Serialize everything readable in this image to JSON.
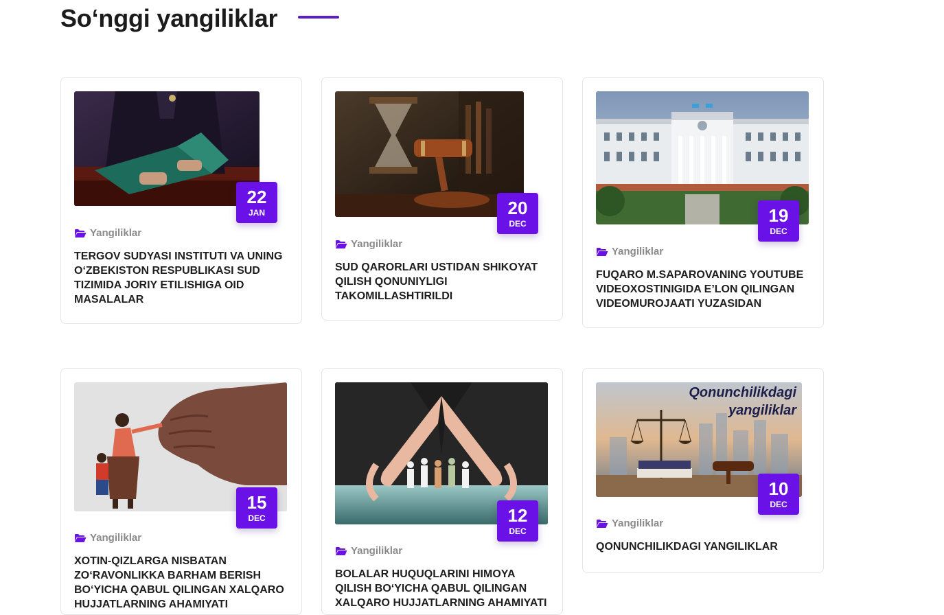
{
  "section": {
    "title": "So‘nggi yangiliklar"
  },
  "colors": {
    "accent": "#6a11e8",
    "title_line": "#5b1fc8",
    "category_text": "#8a8a8a"
  },
  "cards": [
    {
      "image_name": "judge-reading-document-image",
      "day": "22",
      "month": "JAN",
      "category": "Yangiliklar",
      "category_icon": "folder-open-icon",
      "title": "TERGOV SUDYASI INSTITUTI VA UNING O‘ZBEKISTON RESPUBLIKASI SUD TIZIMIDA JORIY ETILISHIGA OID MASALALAR"
    },
    {
      "image_name": "gavel-and-hourglass-image",
      "day": "20",
      "month": "DEC",
      "category": "Yangiliklar",
      "category_icon": "folder-open-icon",
      "title": "SUD QARORLARI USTIDAN SHIKOYAT QILISH QONUNIYLIGI TAKOMILLASHTIRILDI"
    },
    {
      "image_name": "government-building-image",
      "day": "19",
      "month": "DEC",
      "category": "Yangiliklar",
      "category_icon": "folder-open-icon",
      "title": "FUQARO M.SAPAROVANING YOUTUBE VIDEOXOSTINIGIDA E’LON QILINGAN VIDEOMUROJAATI YUZASIDAN"
    },
    {
      "image_name": "fist-and-woman-with-child-illustration",
      "day": "15",
      "month": "DEC",
      "category": "Yangiliklar",
      "category_icon": "folder-open-icon",
      "title": "XOTIN-QIZLARGA NISBATAN ZO‘RAVONLIKKA BARHAM BERISH BO‘YICHA QABUL QILINGAN XALQARO HUJJATLARNING AHAMIYATI"
    },
    {
      "image_name": "hands-protecting-paper-family-image",
      "day": "12",
      "month": "DEC",
      "category": "Yangiliklar",
      "category_icon": "folder-open-icon",
      "title": "BOLALAR HUQUQLARINI HIMOYA QILISH BO‘YICHA QABUL QILINGAN XALQARO HUJJATLARNING AHAMIYATI"
    },
    {
      "image_name": "scales-and-gavel-image",
      "image_caption_line1": "Qonunchilikdagi",
      "image_caption_line2": "yangiliklar",
      "day": "10",
      "month": "DEC",
      "category": "Yangiliklar",
      "category_icon": "folder-open-icon",
      "title": "QONUNCHILIKDAGI YANGILIKLAR"
    }
  ]
}
